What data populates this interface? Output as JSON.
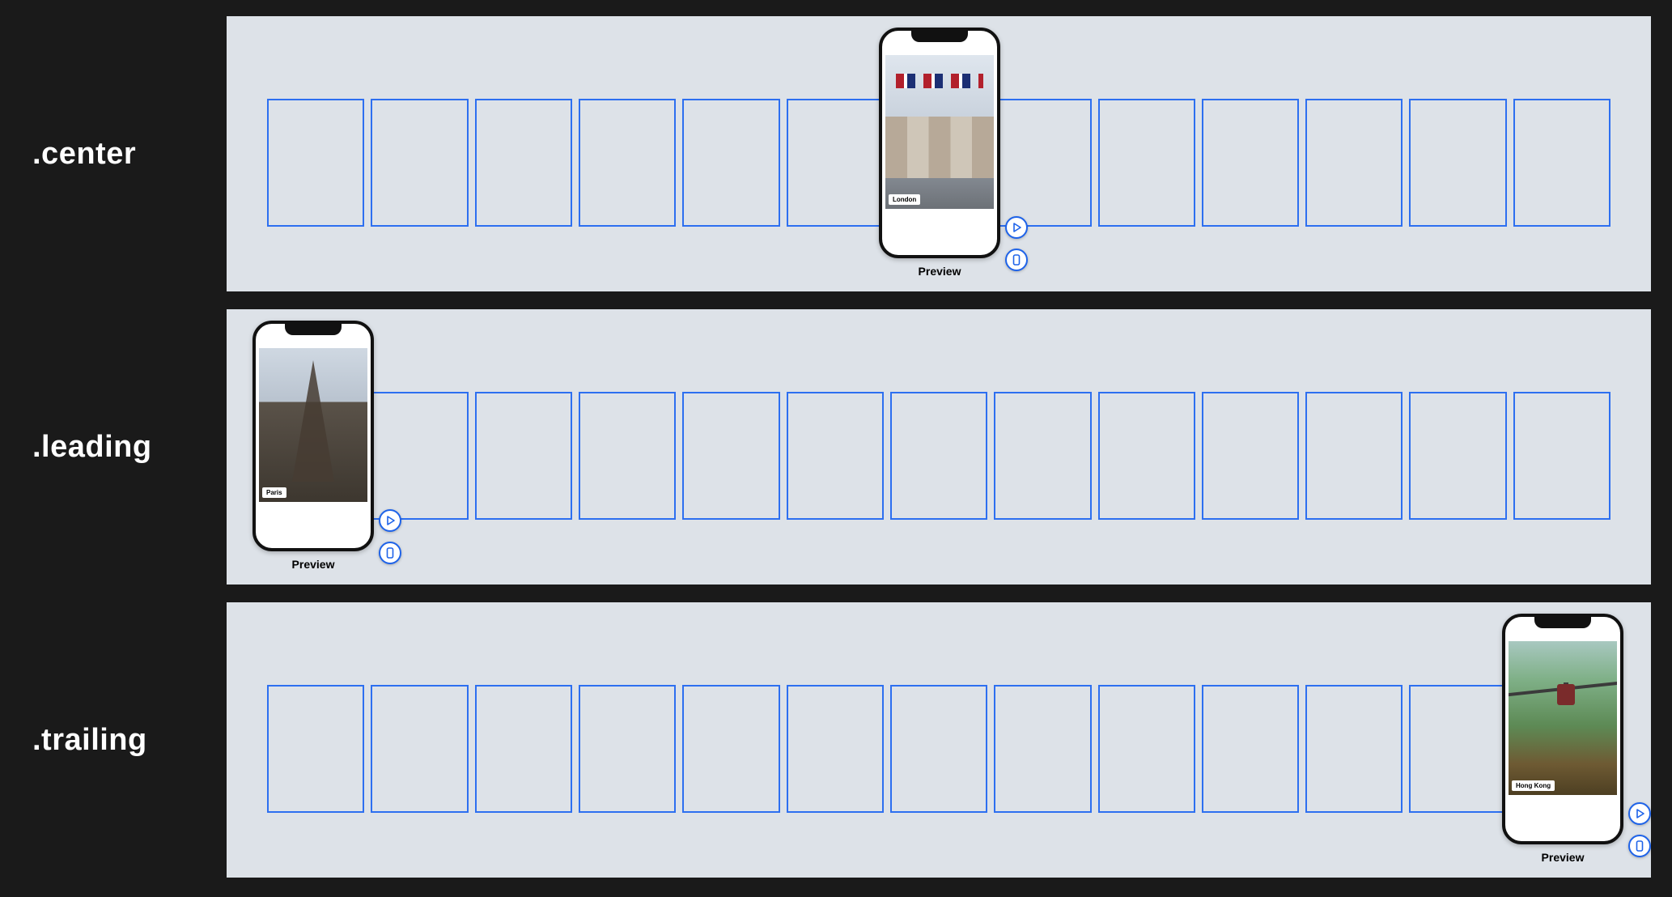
{
  "rows": [
    {
      "key": "center",
      "label": ".center",
      "slot_count": 13,
      "phone": {
        "position": "center",
        "caption": "London",
        "preview_label": "Preview",
        "image": "london"
      }
    },
    {
      "key": "leading",
      "label": ".leading",
      "slot_count": 13,
      "phone": {
        "position": "leading",
        "caption": "Paris",
        "preview_label": "Preview",
        "image": "paris"
      }
    },
    {
      "key": "trailing",
      "label": ".trailing",
      "slot_count": 13,
      "phone": {
        "position": "trailing",
        "caption": "Hong Kong",
        "preview_label": "Preview",
        "image": "hongkong"
      }
    }
  ],
  "buttons": {
    "play": "play-icon",
    "device": "device-icon"
  },
  "colors": {
    "slot_border": "#2d6ff0",
    "panel_bg": "#dde2e8",
    "page_bg": "#1a1a1a",
    "accent": "#1e63e9"
  }
}
